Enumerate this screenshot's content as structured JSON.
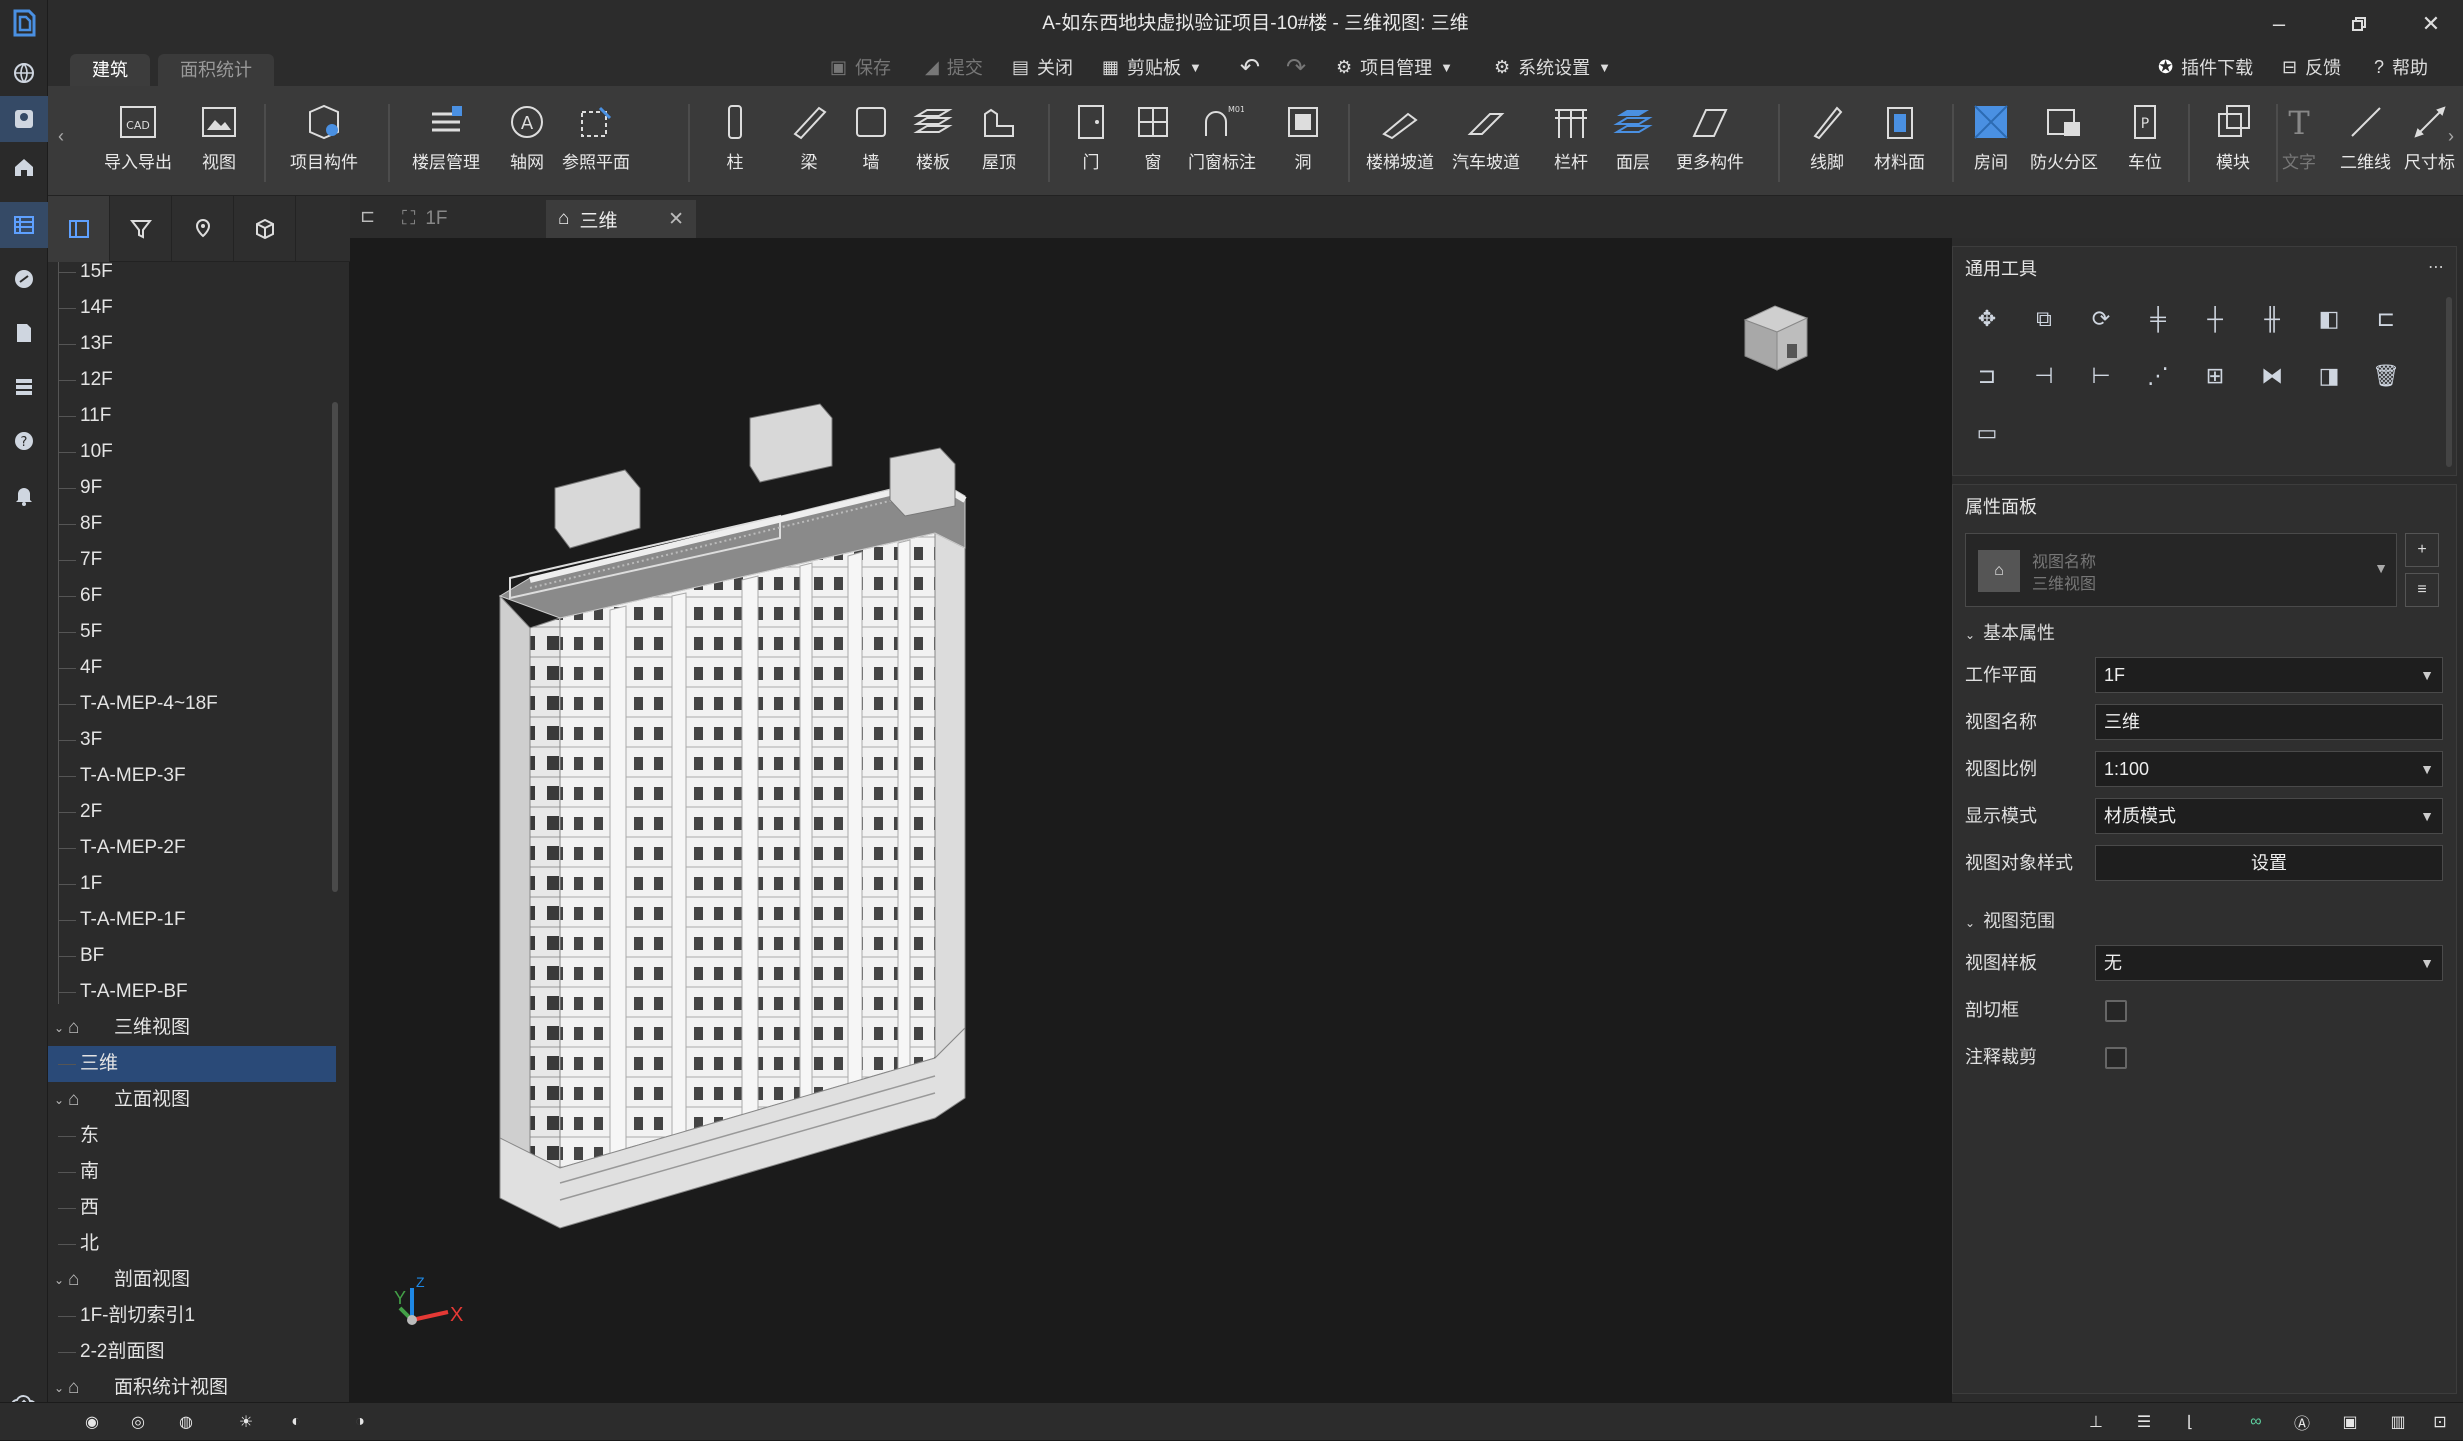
{
  "window": {
    "title": "A-如东西地块虚拟验证项目-10#楼 - 三维视图: 三维",
    "controls": [
      "minimize-icon",
      "restore-icon",
      "close-icon"
    ]
  },
  "ribbon_tabs": [
    {
      "label": "建筑",
      "selected": true
    },
    {
      "label": "面积统计",
      "selected": false
    }
  ],
  "quick_actions": {
    "save": "保存",
    "submit": "提交",
    "close": "关闭",
    "clipboard": "剪贴板",
    "project_mgmt": "项目管理",
    "system_settings": "系统设置",
    "plugin_download": "插件下载",
    "feedback": "反馈",
    "help": "帮助"
  },
  "ribbon_tools": {
    "import_export": "导入导出",
    "view": "视图",
    "project_component": "项目构件",
    "floor_mgmt": "楼层管理",
    "axis": "轴网",
    "ref_plane": "参照平面",
    "column": "柱",
    "beam": "梁",
    "wall": "墙",
    "slab": "楼板",
    "roof": "屋顶",
    "door": "门",
    "window": "窗",
    "door_window_tag": "门窗标注",
    "opening": "洞",
    "stair_ramp": "楼梯坡道",
    "car_ramp": "汽车坡道",
    "railing": "栏杆",
    "surface_layer": "面层",
    "more_components": "更多构件",
    "line_foot": "线脚",
    "material_surface": "材料面",
    "room": "房间",
    "fire_zone": "防火分区",
    "parking": "车位",
    "module": "模块",
    "text": "文字",
    "line_2d": "二维线",
    "dimension": "尺寸标"
  },
  "tree": {
    "floors": [
      "15F",
      "14F",
      "13F",
      "12F",
      "11F",
      "10F",
      "9F",
      "8F",
      "7F",
      "6F",
      "5F",
      "4F",
      "T-A-MEP-4~18F",
      "3F",
      "T-A-MEP-3F",
      "2F",
      "T-A-MEP-2F",
      "1F",
      "T-A-MEP-1F",
      "BF",
      "T-A-MEP-BF"
    ],
    "view3d_group": "三维视图",
    "view3d_items": [
      "三维"
    ],
    "elevation_group": "立面视图",
    "elevation_items": [
      "东",
      "南",
      "西",
      "北"
    ],
    "section_group": "剖面视图",
    "section_items": [
      "1F-剖切索引1",
      "2-2剖面图"
    ],
    "area_group": "面积统计视图"
  },
  "doc_tabs": [
    {
      "label": "1F",
      "active": false
    },
    {
      "label": "三维",
      "active": true
    }
  ],
  "axes": {
    "x": "X",
    "y": "Y",
    "z": "Z"
  },
  "tools_panel": {
    "title": "通用工具"
  },
  "props_panel": {
    "title": "属性面板",
    "view_name_hint": "视图名称",
    "view_type": "三维视图",
    "basic_section": "基本属性",
    "rows": [
      {
        "label": "工作平面",
        "value": "1F",
        "type": "select"
      },
      {
        "label": "视图名称",
        "value": "三维",
        "type": "input"
      },
      {
        "label": "视图比例",
        "value": "1:100",
        "type": "select"
      },
      {
        "label": "显示模式",
        "value": "材质模式",
        "type": "select"
      },
      {
        "label": "视图对象样式",
        "value": "设置",
        "type": "button"
      }
    ],
    "range_section": "视图范围",
    "range_rows": [
      {
        "label": "视图样板",
        "value": "无",
        "type": "select"
      },
      {
        "label": "剖切框",
        "checked": false,
        "type": "checkbox"
      },
      {
        "label": "注释裁剪",
        "checked": false,
        "type": "checkbox"
      }
    ]
  }
}
